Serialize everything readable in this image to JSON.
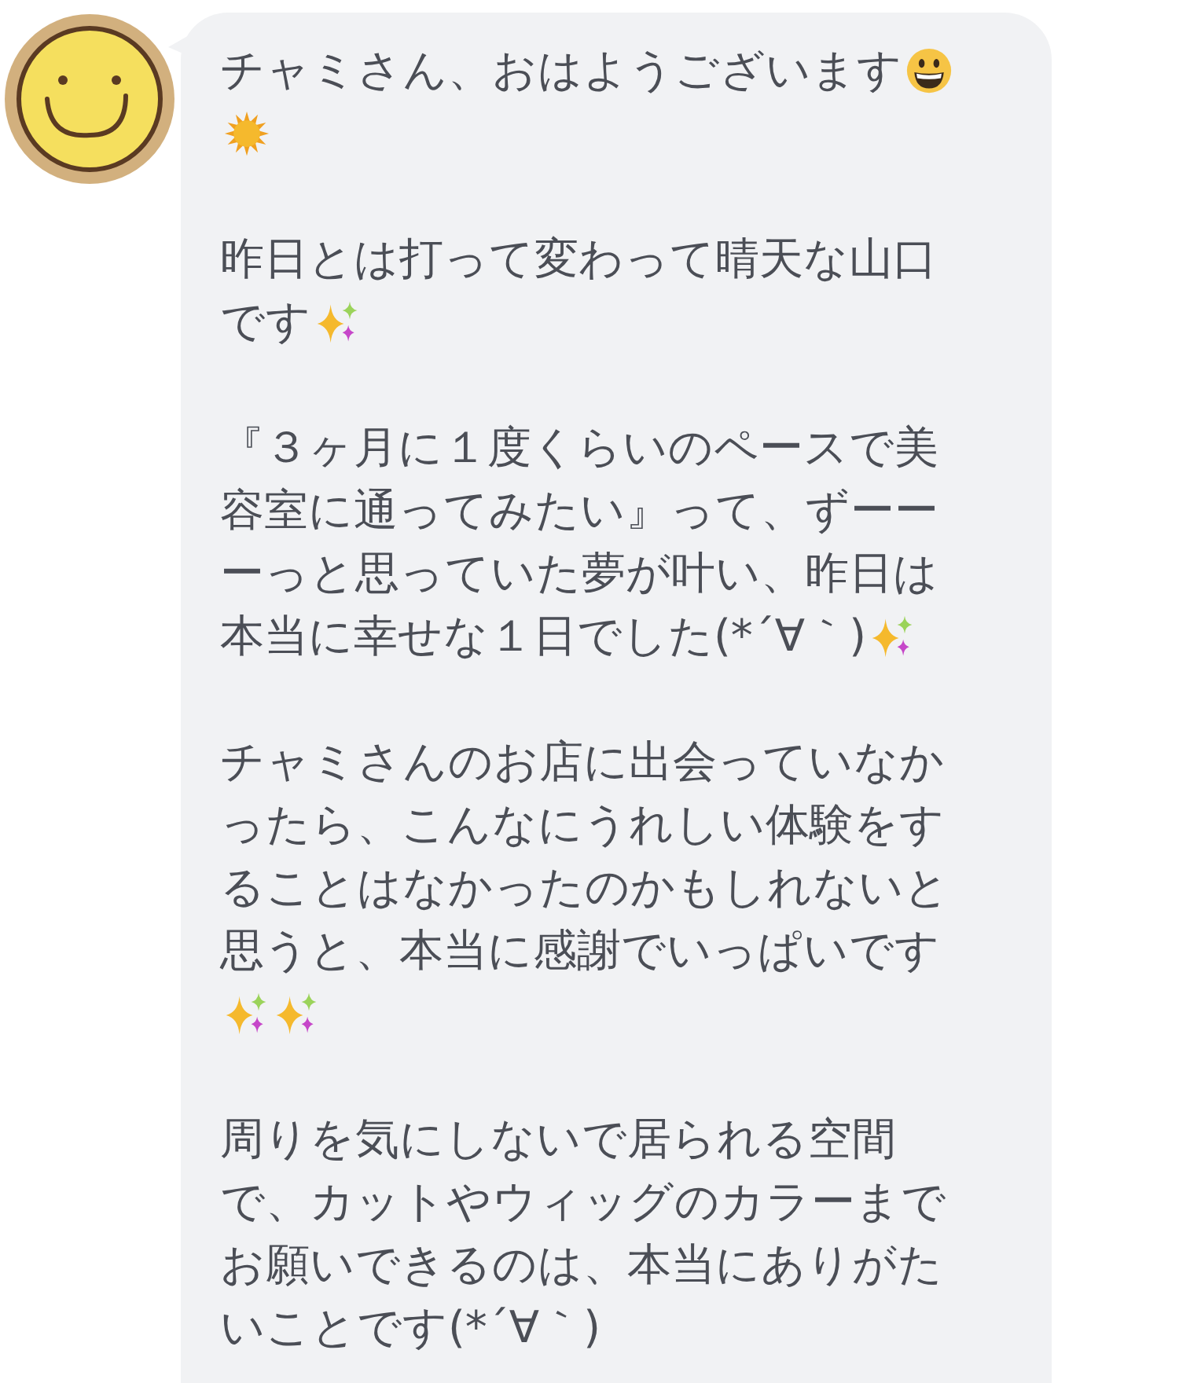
{
  "message": {
    "paragraphs": [
      {
        "lines": [
          [
            {
              "kind": "text",
              "text": "チャミさん、おはようございます"
            },
            {
              "kind": "grin"
            }
          ],
          [
            {
              "kind": "sun"
            }
          ]
        ]
      },
      {
        "lines": [
          [
            {
              "kind": "text",
              "text": "昨日とは打って変わって晴天な山口"
            }
          ],
          [
            {
              "kind": "text",
              "text": "です"
            },
            {
              "kind": "sparkles"
            }
          ]
        ]
      },
      {
        "lines": [
          [
            {
              "kind": "text",
              "text": "『３ヶ月に１度くらいのペースで美"
            }
          ],
          [
            {
              "kind": "text",
              "text": "容室に通ってみたい』って、ずーー"
            }
          ],
          [
            {
              "kind": "text",
              "text": "ーっと思っていた夢が叶い、昨日は"
            }
          ],
          [
            {
              "kind": "text",
              "text": "本当に幸せな１日でした(*´∀｀)"
            },
            {
              "kind": "sparkles"
            }
          ]
        ]
      },
      {
        "lines": [
          [
            {
              "kind": "text",
              "text": "チャミさんのお店に出会っていなか"
            }
          ],
          [
            {
              "kind": "text",
              "text": "ったら、こんなにうれしい体験をす"
            }
          ],
          [
            {
              "kind": "text",
              "text": "ることはなかったのかもしれないと"
            }
          ],
          [
            {
              "kind": "text",
              "text": "思うと、本当に感謝でいっぱいです"
            }
          ],
          [
            {
              "kind": "sparkles"
            },
            {
              "kind": "sparkles"
            }
          ]
        ]
      },
      {
        "lines": [
          [
            {
              "kind": "text",
              "text": "周りを気にしないで居られる空間"
            }
          ],
          [
            {
              "kind": "text",
              "text": "で、カットやウィッグのカラーまで"
            }
          ],
          [
            {
              "kind": "text",
              "text": "お願いできるのは、本当にありがた"
            }
          ],
          [
            {
              "kind": "text",
              "text": "いことです(*´∀｀)"
            }
          ]
        ]
      }
    ]
  }
}
